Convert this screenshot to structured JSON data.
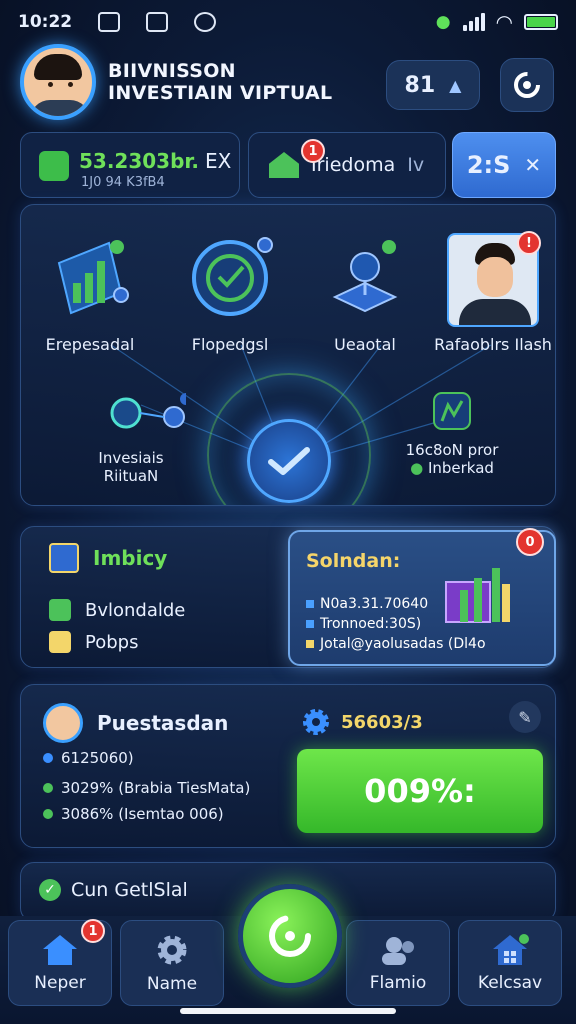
{
  "status_bar": {
    "time": "10:22"
  },
  "header": {
    "title_line1": "BIIVNISSON",
    "title_line2": "INVESTIAIN VIPTUAL",
    "pill_value": "81",
    "settings_icon": "refresh-gear-icon"
  },
  "stats": {
    "balance_value": "53.2303br.",
    "balance_unit": "EX",
    "balance_sub": "1J0 94 K3fB4",
    "mid_label": "Iriedoma",
    "mid_suffix": "Iv",
    "mid_badge": "1",
    "highlight_value": "2:S"
  },
  "hub": {
    "items": [
      {
        "label": "Erepesadal"
      },
      {
        "label": "Flopedgsl"
      },
      {
        "label": "Ueaotal"
      },
      {
        "label": "Rafaoblrs Ilash"
      }
    ],
    "left_label_line1": "Invesiais",
    "left_label_line2": "RiituaN",
    "right_label_line1": "16c8oN pror",
    "right_label_line2": "Inberkad",
    "avatar_badge": "!"
  },
  "features": {
    "heading": "Imbicy",
    "rows": [
      {
        "label": "Bvlondalde"
      },
      {
        "label": "Pobps"
      }
    ]
  },
  "summary": {
    "title": "Solndan:",
    "badge": "0",
    "lines": [
      "N0a3.31.70640",
      "Tronnoed:30S)",
      "Jotal@yaolusadas (Dl4o"
    ]
  },
  "progress": {
    "title": "Puestasdan",
    "gear_value": "56603/3",
    "line1": "6125060)",
    "line2": "3029% (Brabia TiesMata)",
    "line3": "3086% (Isemtao 006)",
    "big_value": "009%:"
  },
  "checklist": {
    "item": "Cun GetlSlal"
  },
  "tabbar": {
    "tabs": [
      {
        "label": "Neper",
        "badge": "1"
      },
      {
        "label": "Name"
      },
      {
        "label": "Flamio"
      },
      {
        "label": "Kelcsav"
      }
    ]
  },
  "colors": {
    "accent_green": "#4cc25a",
    "accent_blue": "#3aa0ff",
    "badge_red": "#e3342f",
    "gold": "#f3d66a"
  }
}
